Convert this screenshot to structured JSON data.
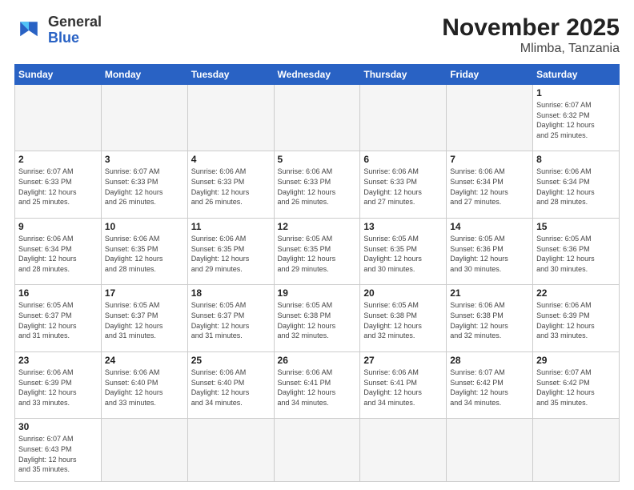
{
  "header": {
    "logo_general": "General",
    "logo_blue": "Blue",
    "title": "November 2025",
    "subtitle": "Mlimba, Tanzania"
  },
  "days_of_week": [
    "Sunday",
    "Monday",
    "Tuesday",
    "Wednesday",
    "Thursday",
    "Friday",
    "Saturday"
  ],
  "weeks": [
    [
      {
        "day": "",
        "info": ""
      },
      {
        "day": "",
        "info": ""
      },
      {
        "day": "",
        "info": ""
      },
      {
        "day": "",
        "info": ""
      },
      {
        "day": "",
        "info": ""
      },
      {
        "day": "",
        "info": ""
      },
      {
        "day": "1",
        "info": "Sunrise: 6:07 AM\nSunset: 6:32 PM\nDaylight: 12 hours\nand 25 minutes."
      }
    ],
    [
      {
        "day": "2",
        "info": "Sunrise: 6:07 AM\nSunset: 6:33 PM\nDaylight: 12 hours\nand 25 minutes."
      },
      {
        "day": "3",
        "info": "Sunrise: 6:07 AM\nSunset: 6:33 PM\nDaylight: 12 hours\nand 26 minutes."
      },
      {
        "day": "4",
        "info": "Sunrise: 6:06 AM\nSunset: 6:33 PM\nDaylight: 12 hours\nand 26 minutes."
      },
      {
        "day": "5",
        "info": "Sunrise: 6:06 AM\nSunset: 6:33 PM\nDaylight: 12 hours\nand 26 minutes."
      },
      {
        "day": "6",
        "info": "Sunrise: 6:06 AM\nSunset: 6:33 PM\nDaylight: 12 hours\nand 27 minutes."
      },
      {
        "day": "7",
        "info": "Sunrise: 6:06 AM\nSunset: 6:34 PM\nDaylight: 12 hours\nand 27 minutes."
      },
      {
        "day": "8",
        "info": "Sunrise: 6:06 AM\nSunset: 6:34 PM\nDaylight: 12 hours\nand 28 minutes."
      }
    ],
    [
      {
        "day": "9",
        "info": "Sunrise: 6:06 AM\nSunset: 6:34 PM\nDaylight: 12 hours\nand 28 minutes."
      },
      {
        "day": "10",
        "info": "Sunrise: 6:06 AM\nSunset: 6:35 PM\nDaylight: 12 hours\nand 28 minutes."
      },
      {
        "day": "11",
        "info": "Sunrise: 6:06 AM\nSunset: 6:35 PM\nDaylight: 12 hours\nand 29 minutes."
      },
      {
        "day": "12",
        "info": "Sunrise: 6:05 AM\nSunset: 6:35 PM\nDaylight: 12 hours\nand 29 minutes."
      },
      {
        "day": "13",
        "info": "Sunrise: 6:05 AM\nSunset: 6:35 PM\nDaylight: 12 hours\nand 30 minutes."
      },
      {
        "day": "14",
        "info": "Sunrise: 6:05 AM\nSunset: 6:36 PM\nDaylight: 12 hours\nand 30 minutes."
      },
      {
        "day": "15",
        "info": "Sunrise: 6:05 AM\nSunset: 6:36 PM\nDaylight: 12 hours\nand 30 minutes."
      }
    ],
    [
      {
        "day": "16",
        "info": "Sunrise: 6:05 AM\nSunset: 6:37 PM\nDaylight: 12 hours\nand 31 minutes."
      },
      {
        "day": "17",
        "info": "Sunrise: 6:05 AM\nSunset: 6:37 PM\nDaylight: 12 hours\nand 31 minutes."
      },
      {
        "day": "18",
        "info": "Sunrise: 6:05 AM\nSunset: 6:37 PM\nDaylight: 12 hours\nand 31 minutes."
      },
      {
        "day": "19",
        "info": "Sunrise: 6:05 AM\nSunset: 6:38 PM\nDaylight: 12 hours\nand 32 minutes."
      },
      {
        "day": "20",
        "info": "Sunrise: 6:05 AM\nSunset: 6:38 PM\nDaylight: 12 hours\nand 32 minutes."
      },
      {
        "day": "21",
        "info": "Sunrise: 6:06 AM\nSunset: 6:38 PM\nDaylight: 12 hours\nand 32 minutes."
      },
      {
        "day": "22",
        "info": "Sunrise: 6:06 AM\nSunset: 6:39 PM\nDaylight: 12 hours\nand 33 minutes."
      }
    ],
    [
      {
        "day": "23",
        "info": "Sunrise: 6:06 AM\nSunset: 6:39 PM\nDaylight: 12 hours\nand 33 minutes."
      },
      {
        "day": "24",
        "info": "Sunrise: 6:06 AM\nSunset: 6:40 PM\nDaylight: 12 hours\nand 33 minutes."
      },
      {
        "day": "25",
        "info": "Sunrise: 6:06 AM\nSunset: 6:40 PM\nDaylight: 12 hours\nand 34 minutes."
      },
      {
        "day": "26",
        "info": "Sunrise: 6:06 AM\nSunset: 6:41 PM\nDaylight: 12 hours\nand 34 minutes."
      },
      {
        "day": "27",
        "info": "Sunrise: 6:06 AM\nSunset: 6:41 PM\nDaylight: 12 hours\nand 34 minutes."
      },
      {
        "day": "28",
        "info": "Sunrise: 6:07 AM\nSunset: 6:42 PM\nDaylight: 12 hours\nand 34 minutes."
      },
      {
        "day": "29",
        "info": "Sunrise: 6:07 AM\nSunset: 6:42 PM\nDaylight: 12 hours\nand 35 minutes."
      }
    ],
    [
      {
        "day": "30",
        "info": "Sunrise: 6:07 AM\nSunset: 6:43 PM\nDaylight: 12 hours\nand 35 minutes."
      },
      {
        "day": "",
        "info": ""
      },
      {
        "day": "",
        "info": ""
      },
      {
        "day": "",
        "info": ""
      },
      {
        "day": "",
        "info": ""
      },
      {
        "day": "",
        "info": ""
      },
      {
        "day": "",
        "info": ""
      }
    ]
  ]
}
